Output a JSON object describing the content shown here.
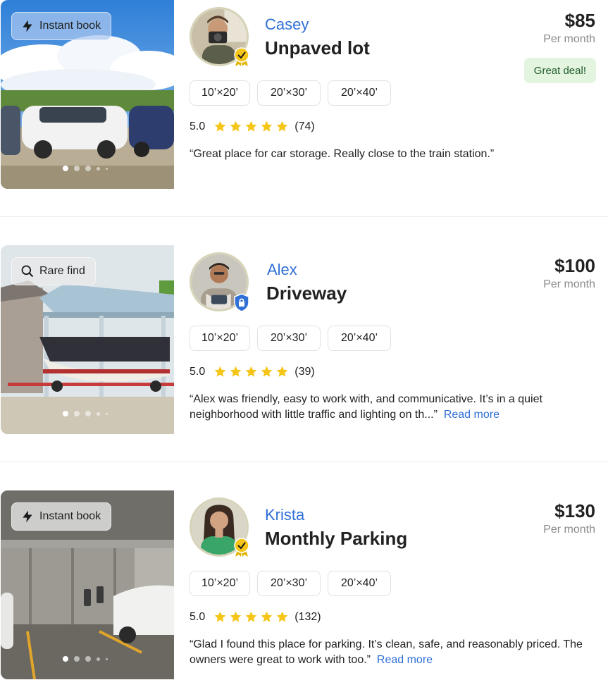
{
  "colors": {
    "accent": "#2f6fd6",
    "star": "#f5c518",
    "deal_bg": "#e3f4df",
    "deal_text": "#1d5a2a",
    "muted": "#8a8a8a"
  },
  "listings": [
    {
      "badge": {
        "icon": "lightning-icon",
        "label": "Instant book"
      },
      "host": {
        "name": "Casey",
        "badge_icon": "verified-ribbon-icon"
      },
      "title": "Unpaved lot",
      "price": "$85",
      "price_unit": "Per month",
      "tag": "Great deal!",
      "sizes": [
        "10’×20’",
        "20’×30’",
        "20’×40’"
      ],
      "rating": "5.0",
      "stars": 5,
      "review_count": "(74)",
      "review": "“Great place for car storage. Really close to the train station.”",
      "read_more": ""
    },
    {
      "badge": {
        "icon": "search-icon",
        "label": "Rare find"
      },
      "host": {
        "name": "Alex",
        "badge_icon": "lock-shield-icon"
      },
      "title": "Driveway",
      "price": "$100",
      "price_unit": "Per month",
      "tag": "",
      "sizes": [
        "10’×20’",
        "20’×30’",
        "20’×40’"
      ],
      "rating": "5.0",
      "stars": 5,
      "review_count": "(39)",
      "review": "“Alex was friendly, easy to work with, and communicative. It’s in a quiet neighborhood with little traffic and lighting on th...”",
      "read_more": "Read more"
    },
    {
      "badge": {
        "icon": "lightning-icon",
        "label": "Instant book"
      },
      "host": {
        "name": "Krista",
        "badge_icon": "verified-ribbon-icon"
      },
      "title": "Monthly Parking",
      "price": "$130",
      "price_unit": "Per month",
      "tag": "",
      "sizes": [
        "10’×20’",
        "20’×30’",
        "20’×40’"
      ],
      "rating": "5.0",
      "stars": 5,
      "review_count": "(132)",
      "review": "“Glad I found this place for parking. It’s clean, safe, and reasonably priced. The owners were great to work with too.”",
      "read_more": "Read more"
    }
  ]
}
